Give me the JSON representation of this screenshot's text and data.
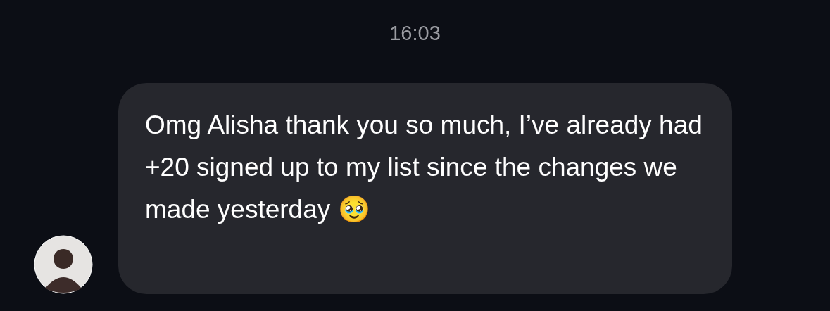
{
  "timestamp": "16:03",
  "message": {
    "text": "Omg Alisha thank you so much, I’ve already had +20 signed up to my list since the changes we made yesterday 🥹"
  }
}
